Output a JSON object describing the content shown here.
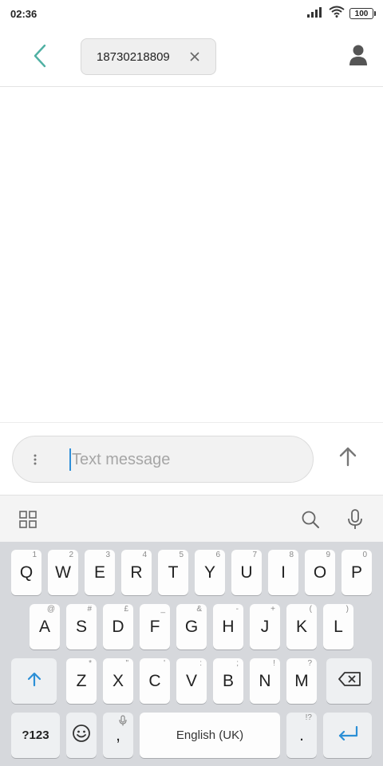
{
  "status_bar": {
    "time": "02:36",
    "battery": "100"
  },
  "header": {
    "recipient": "18730218809"
  },
  "compose": {
    "placeholder": "Text message"
  },
  "keyboard": {
    "row1": [
      {
        "label": "Q",
        "sub": "1"
      },
      {
        "label": "W",
        "sub": "2"
      },
      {
        "label": "E",
        "sub": "3"
      },
      {
        "label": "R",
        "sub": "4"
      },
      {
        "label": "T",
        "sub": "5"
      },
      {
        "label": "Y",
        "sub": "6"
      },
      {
        "label": "U",
        "sub": "7"
      },
      {
        "label": "I",
        "sub": "8"
      },
      {
        "label": "O",
        "sub": "9"
      },
      {
        "label": "P",
        "sub": "0"
      }
    ],
    "row2": [
      {
        "label": "A",
        "sub": "@"
      },
      {
        "label": "S",
        "sub": "#"
      },
      {
        "label": "D",
        "sub": "£"
      },
      {
        "label": "F",
        "sub": "_"
      },
      {
        "label": "G",
        "sub": "&"
      },
      {
        "label": "H",
        "sub": "-"
      },
      {
        "label": "J",
        "sub": "+"
      },
      {
        "label": "K",
        "sub": "("
      },
      {
        "label": "L",
        "sub": ")"
      }
    ],
    "row3": [
      {
        "label": "Z",
        "sub": "*"
      },
      {
        "label": "X",
        "sub": "\""
      },
      {
        "label": "C",
        "sub": "'"
      },
      {
        "label": "V",
        "sub": ":"
      },
      {
        "label": "B",
        "sub": ";"
      },
      {
        "label": "N",
        "sub": "!"
      },
      {
        "label": "M",
        "sub": "?"
      }
    ],
    "symbols_label": "?123",
    "comma_label": ",",
    "space_label": "English (UK)",
    "period_label": ".",
    "period_sub": "!?"
  },
  "icons": {
    "back": "chevron-left-icon",
    "chip_close": "close-icon",
    "contact": "person-icon",
    "more": "more-vertical-icon",
    "send": "arrow-up-icon",
    "apps": "grid-icon",
    "search": "search-icon",
    "mic": "mic-icon",
    "shift": "shift-icon",
    "backspace": "backspace-icon",
    "emoji": "emoji-icon",
    "enter": "enter-icon"
  },
  "colors": {
    "accent": "#4fb0a3",
    "key_blue": "#2b8fd6",
    "keyboard_bg": "#d6d8dc"
  }
}
